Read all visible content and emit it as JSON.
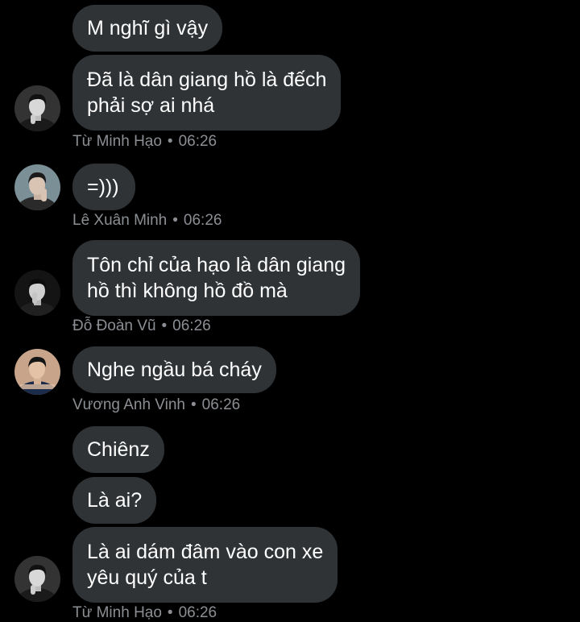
{
  "messages": [
    {
      "lines": [
        "M nghĩ gì vậy"
      ]
    },
    {
      "lines": [
        "Đã là dân giang hồ là đếch",
        "phải sợ ai nhá"
      ]
    },
    {
      "lines": [
        "=)))"
      ]
    },
    {
      "lines": [
        "Tôn chỉ của hạo là dân giang",
        "hồ thì không hồ đồ mà"
      ]
    },
    {
      "lines": [
        "Nghe ngầu bá cháy"
      ]
    },
    {
      "lines": [
        "Chiênz"
      ]
    },
    {
      "lines": [
        "Là ai?"
      ]
    },
    {
      "lines": [
        "Là ai dám đâm vào con xe",
        "yêu quý của t"
      ]
    }
  ],
  "meta": [
    {
      "name": "Từ Minh Hạo",
      "sep": "•",
      "time": "06:26"
    },
    {
      "name": "Lê Xuân Minh",
      "sep": "•",
      "time": "06:26"
    },
    {
      "name": "Đỗ Đoàn Vũ",
      "sep": "•",
      "time": "06:26"
    },
    {
      "name": "Vương Anh Vinh",
      "sep": "•",
      "time": "06:26"
    },
    {
      "name": "Từ Minh Hạo",
      "sep": "•",
      "time": "06:26"
    }
  ],
  "avatars": [
    {
      "icon": "user-avatar-photo",
      "bg": "#3a3a3a",
      "face": "#d8d8d8",
      "hair": "#111111",
      "shirt": "#1a1a1a"
    },
    {
      "icon": "user-avatar-photo",
      "bg": "#7a8f96",
      "face": "#d9c4b4",
      "hair": "#1b1b1b",
      "shirt": "#2a2a2a"
    },
    {
      "icon": "user-avatar-photo",
      "bg": "#141414",
      "face": "#cfcfcf",
      "hair": "#0c0c0c",
      "shirt": "#202020"
    },
    {
      "icon": "user-avatar-photo",
      "bg": "#c7a48a",
      "face": "#e3c2a6",
      "hair": "#151515",
      "shirt": "#1d2b4a"
    },
    {
      "icon": "user-avatar-photo",
      "bg": "#3a3a3a",
      "face": "#d8d8d8",
      "hair": "#111111",
      "shirt": "#1a1a1a"
    }
  ],
  "colors": {
    "background": "#000000",
    "bubble": "#2f3336",
    "text": "#ffffff",
    "meta_text": "#8b8f94"
  }
}
